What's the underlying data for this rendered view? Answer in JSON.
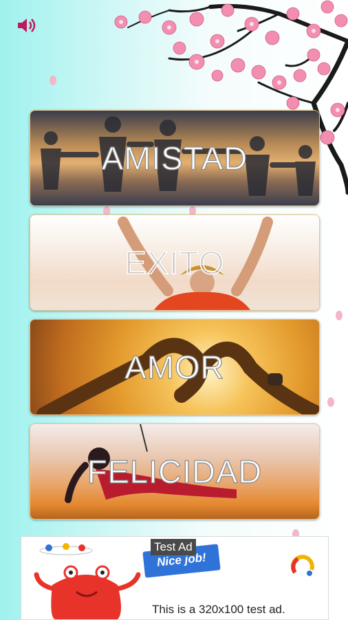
{
  "cards": [
    {
      "label": "AMISTAD"
    },
    {
      "label": "EXITO"
    },
    {
      "label": "AMOR"
    },
    {
      "label": "FELICIDAD"
    }
  ],
  "ad": {
    "badge": "Test Ad",
    "banner": "Nice job!",
    "text": "This is a 320x100 test ad."
  },
  "icons": {
    "sound": "speaker-icon",
    "ad_logo": "ad-brand-icon"
  },
  "colors": {
    "accent": "#c2185b",
    "ad_blue": "#2f73d9",
    "ad_red": "#e8332a"
  }
}
